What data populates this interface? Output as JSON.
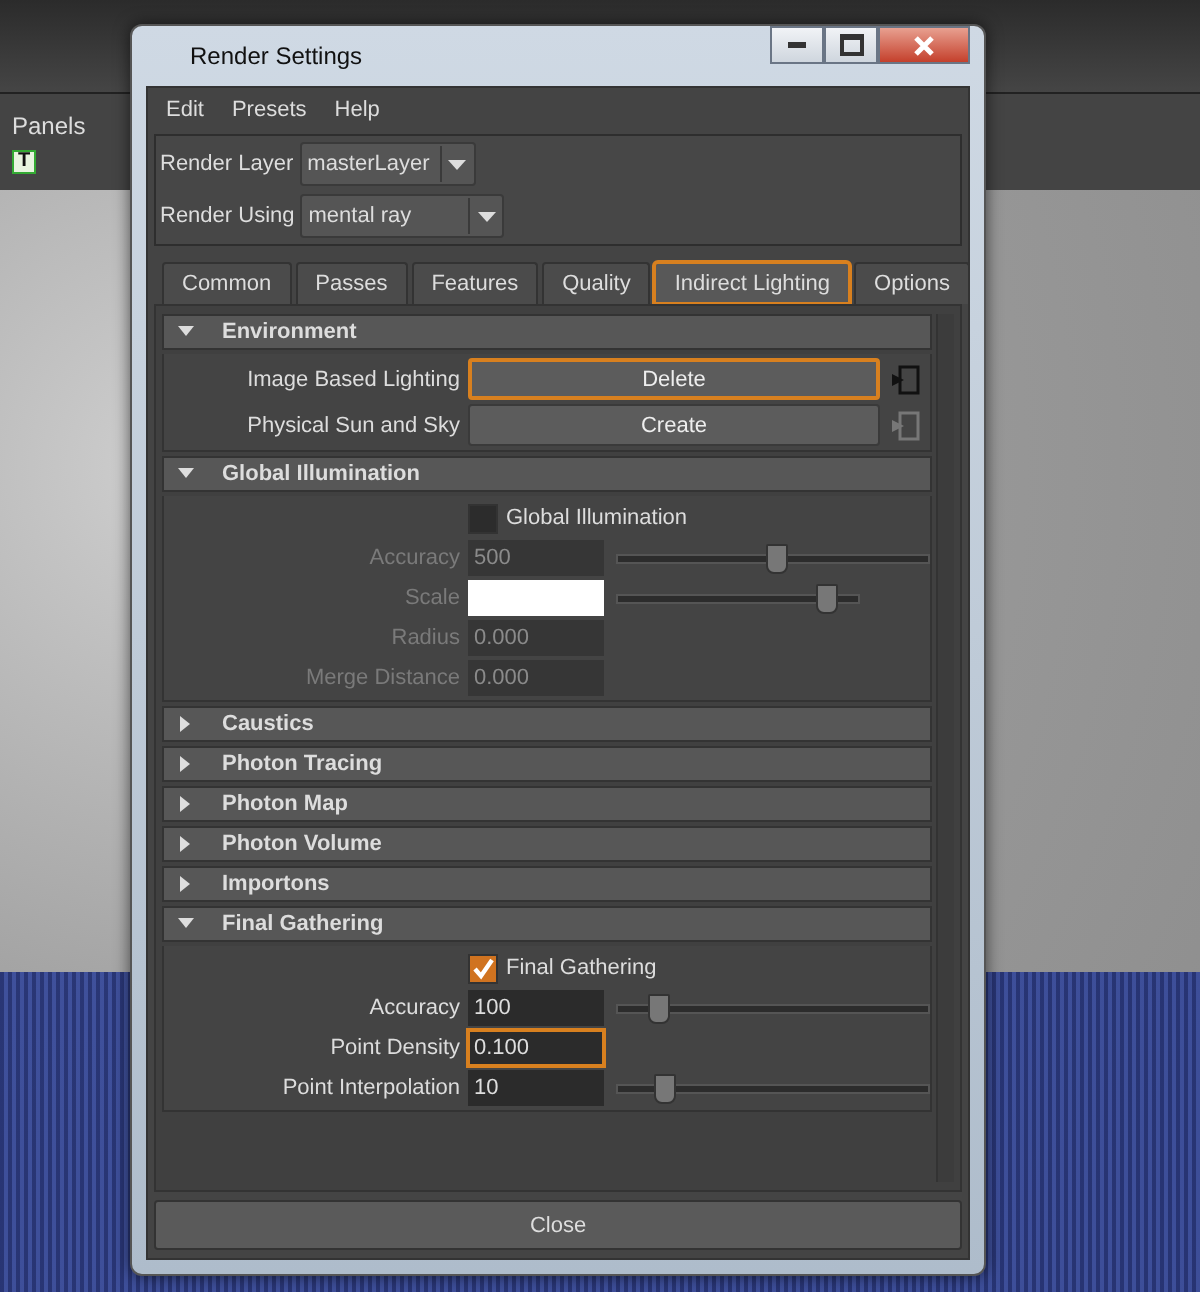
{
  "background": {
    "panels_label": "Panels",
    "toolbar_glyph": "T"
  },
  "window": {
    "title": "Render Settings",
    "menu": [
      "Edit",
      "Presets",
      "Help"
    ]
  },
  "render_layer": {
    "label": "Render Layer",
    "value": "masterLayer"
  },
  "render_using": {
    "label": "Render Using",
    "value": "mental ray"
  },
  "tabs": [
    {
      "label": "Common",
      "selected": false
    },
    {
      "label": "Passes",
      "selected": false
    },
    {
      "label": "Features",
      "selected": false
    },
    {
      "label": "Quality",
      "selected": false
    },
    {
      "label": "Indirect Lighting",
      "selected": true
    },
    {
      "label": "Options",
      "selected": false
    }
  ],
  "sections": [
    {
      "title": "Environment",
      "expanded": true,
      "rows": [
        {
          "kind": "button",
          "label": "Image Based Lighting",
          "button": "Delete",
          "highlighted": true,
          "connected": true
        },
        {
          "kind": "button",
          "label": "Physical Sun and Sky",
          "button": "Create",
          "highlighted": false,
          "connected": false
        }
      ]
    },
    {
      "title": "Global Illumination",
      "expanded": true,
      "rows": [
        {
          "kind": "checkbox",
          "label": "Global Illumination",
          "checked": false
        },
        {
          "kind": "field",
          "label": "Accuracy",
          "value": "500",
          "disabled": true,
          "highlighted": false,
          "level": 0.5
        },
        {
          "kind": "color",
          "label": "Scale",
          "disabled": true,
          "level": 0.86
        },
        {
          "kind": "field",
          "label": "Radius",
          "value": "0.000",
          "disabled": true,
          "highlighted": false
        },
        {
          "kind": "field",
          "label": "Merge Distance",
          "value": "0.000",
          "disabled": true,
          "highlighted": false
        }
      ]
    },
    {
      "title": "Caustics",
      "expanded": false
    },
    {
      "title": "Photon Tracing",
      "expanded": false
    },
    {
      "title": "Photon Map",
      "expanded": false
    },
    {
      "title": "Photon Volume",
      "expanded": false
    },
    {
      "title": "Importons",
      "expanded": false
    },
    {
      "title": "Final Gathering",
      "expanded": true,
      "rows": [
        {
          "kind": "checkbox",
          "label": "Final Gathering",
          "checked": true
        },
        {
          "kind": "field",
          "label": "Accuracy",
          "value": "100",
          "disabled": false,
          "highlighted": false,
          "level": 0.12
        },
        {
          "kind": "field",
          "label": "Point Density",
          "value": "0.100",
          "disabled": false,
          "highlighted": true
        },
        {
          "kind": "field",
          "label": "Point Interpolation",
          "value": "10",
          "disabled": false,
          "highlighted": false,
          "level": 0.14
        }
      ]
    }
  ],
  "close_button": "Close"
}
